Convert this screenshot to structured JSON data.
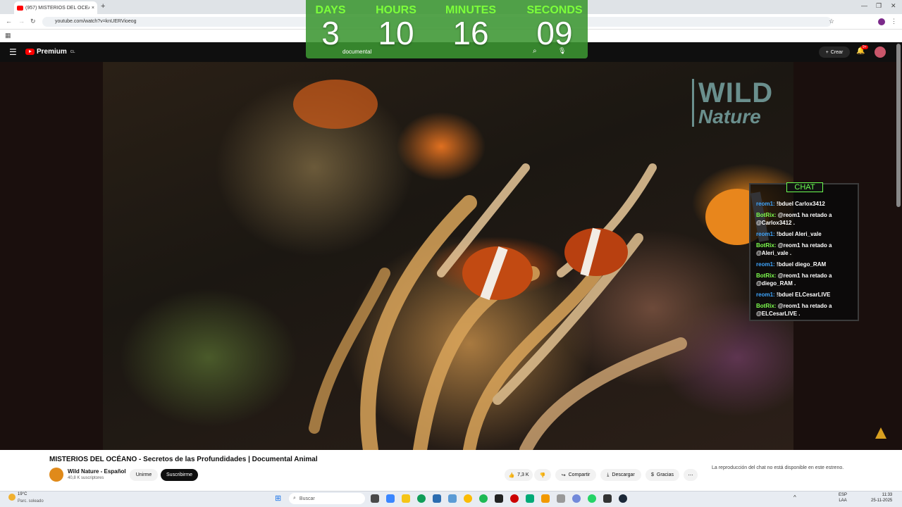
{
  "browser": {
    "tab_title": "(957) MISTERIOS DEL OCÉA",
    "url": "youtube.com/watch?v=knUERVioeog",
    "tab_close": "×",
    "new_tab": "+"
  },
  "youtube": {
    "brand": "Premium",
    "region": "CL",
    "search_query": "documental",
    "create_label": "Crear",
    "notifications_badge": "9+"
  },
  "countdown": {
    "labels": [
      "DAYS",
      "HOURS",
      "MINUTES",
      "SECONDS"
    ],
    "values": [
      "3",
      "10",
      "16",
      "09"
    ]
  },
  "video": {
    "watermark_line1": "WILD",
    "watermark_line2": "Nature"
  },
  "chat": {
    "title": "CHAT",
    "messages": [
      {
        "user": "reom1:",
        "text": "!bduel Carlox3412",
        "bot": false
      },
      {
        "user": "BotRix:",
        "text": "@reom1 ha retado a @Carlox3412 .",
        "bot": true
      },
      {
        "user": "reom1:",
        "text": "!bduel Aleri_vale",
        "bot": false
      },
      {
        "user": "BotRix:",
        "text": "@reom1 ha retado a @Aleri_vale .",
        "bot": true
      },
      {
        "user": "reom1:",
        "text": "!bduel diego_RAM",
        "bot": false
      },
      {
        "user": "BotRix:",
        "text": "@reom1 ha retado a @diego_RAM .",
        "bot": true
      },
      {
        "user": "reom1:",
        "text": "!bduel ELCesarLIVE",
        "bot": false
      },
      {
        "user": "BotRix:",
        "text": "@reom1 ha retado a @ELCesarLIVE .",
        "bot": true
      }
    ]
  },
  "info": {
    "title": "MISTERIOS DEL OCÉANO - Secretos de las Profundidades | Documental Animal",
    "channel": "Wild Nature - Español",
    "subscribers": "40,8 K suscriptores",
    "join": "Unirme",
    "subscribe": "Suscribirme",
    "likes": "7,3 K",
    "share": "Compartir",
    "download": "Descargar",
    "thanks": "Gracias",
    "chat_unavailable": "La reproducción del chat no está disponible en este estreno."
  },
  "taskbar": {
    "temp": "19°C",
    "weather": "Parc. soleado",
    "search": "Buscar",
    "lang1": "ESP",
    "lang2": "LAA",
    "time": "11:33",
    "date": "25-11-2025"
  }
}
